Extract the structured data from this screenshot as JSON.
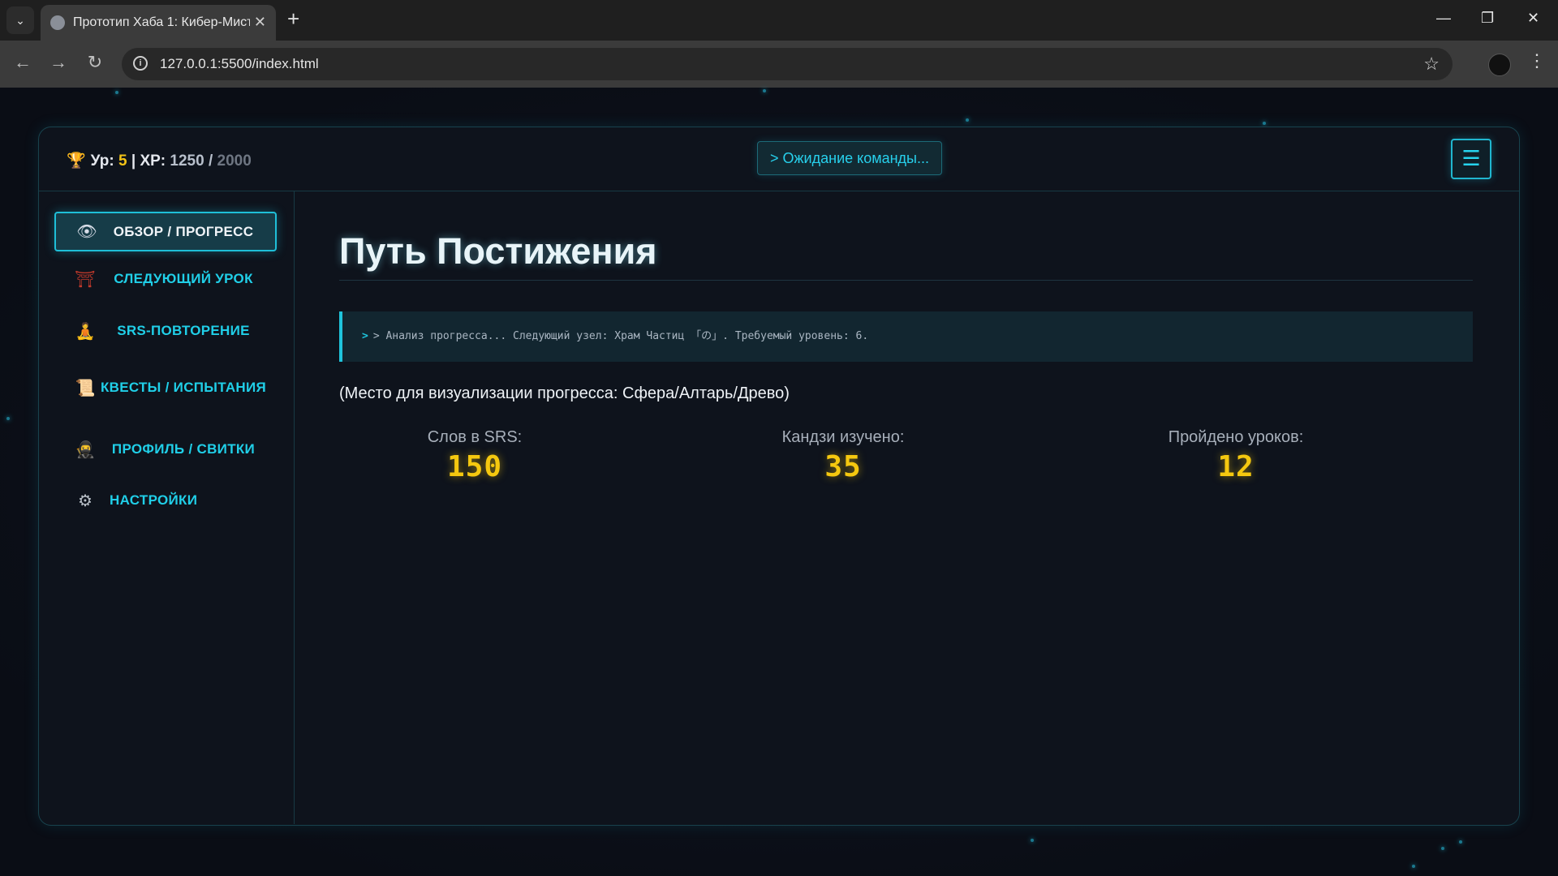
{
  "browser": {
    "tab_title": "Прототип Хаба 1: Кибер-Мистика",
    "url": "127.0.0.1:5500/index.html"
  },
  "hud": {
    "level_label": "Ур:",
    "level_value": "5",
    "separator": "|",
    "xp_label": "XP:",
    "xp_current": "1250",
    "xp_slash": "/",
    "xp_max": "2000",
    "command_button": "> Ожидание команды..."
  },
  "sidebar": {
    "items": [
      {
        "label": "ОБЗОР / ПРОГРЕСС",
        "icon": "eye-icon",
        "active": true
      },
      {
        "label": "СЛЕДУЮЩИЙ УРОК",
        "icon": "torii-gate-icon",
        "active": false
      },
      {
        "label": "SRS-ПОВТОРЕНИЕ",
        "icon": "meditation-icon",
        "active": false
      },
      {
        "label": "КВЕСТЫ / ИСПЫТАНИЯ",
        "icon": "scroll-icon",
        "active": false
      },
      {
        "label": "ПРОФИЛЬ / СВИТКИ",
        "icon": "ninja-icon",
        "active": false
      },
      {
        "label": "НАСТРОЙКИ",
        "icon": "gear-icon",
        "active": false
      }
    ]
  },
  "main": {
    "title": "Путь Постижения",
    "console_prompt": ">",
    "console_text": "> Анализ прогресса... Следующий узел: Храм Частиц 「の」. Требуемый уровень: 6.",
    "placeholder": "(Место для визуализации прогресса: Сфера/Алтарь/Древо)",
    "stats": [
      {
        "label": "Слов в SRS:",
        "value": "150"
      },
      {
        "label": "Кандзи изучено:",
        "value": "35"
      },
      {
        "label": "Пройдено уроков:",
        "value": "12"
      }
    ]
  },
  "colors": {
    "accent": "#1fc4dc",
    "gold": "#f5c80f",
    "background": "#0b0f18"
  }
}
